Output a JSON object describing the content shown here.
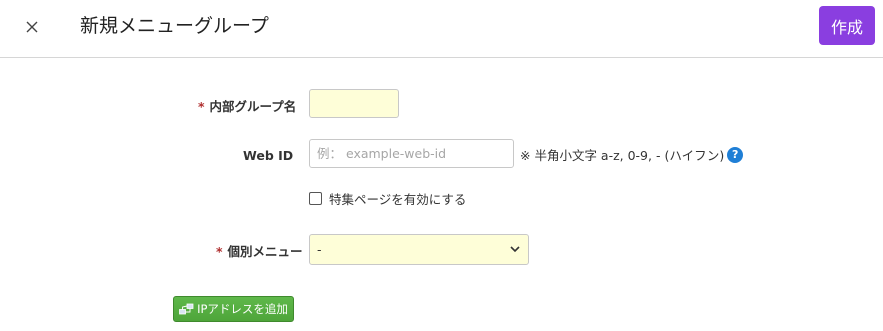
{
  "header": {
    "close_icon": "close-icon",
    "title": "新規メニューグループ",
    "create_label": "作成"
  },
  "form": {
    "required_mark": "*",
    "group_name": {
      "label": "内部グループ名",
      "value": ""
    },
    "web_id": {
      "label": "Web ID",
      "value": "",
      "placeholder": "例： example-web-id",
      "hint": "※ 半角小文字 a-z, 0-9, - (ハイフン)",
      "help_icon": "question-circle-icon",
      "help_glyph": "?"
    },
    "special_page": {
      "checked": false,
      "label": "特集ページを有効にする"
    },
    "individual_menu": {
      "label": "個別メニュー",
      "selected": "-"
    },
    "add_ip_button": {
      "label": "IPアドレスを追加",
      "icon": "network-icon"
    }
  },
  "colors": {
    "accent": "#8a3ee0",
    "required": "#b03030",
    "help": "#1f7fd6",
    "highlight_field": "#fefed8",
    "button_green": "#4ea53a"
  }
}
